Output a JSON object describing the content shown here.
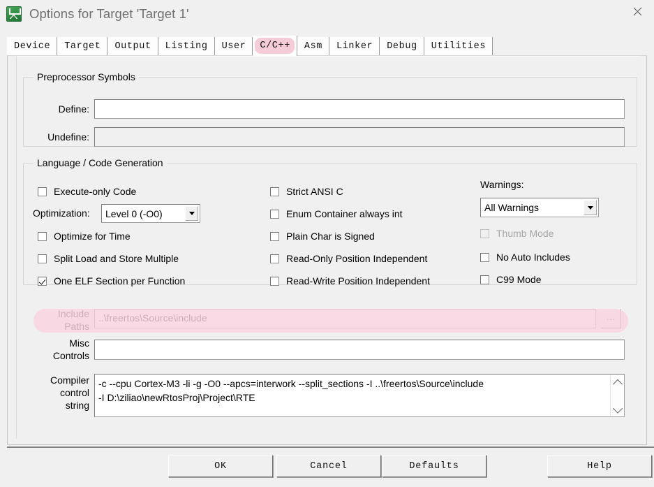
{
  "window": {
    "title": "Options for Target 'Target 1'",
    "icon": "uvision-logo-icon",
    "close_label": "✕"
  },
  "tabs": [
    {
      "label": "Device",
      "selected": false
    },
    {
      "label": "Target",
      "selected": false
    },
    {
      "label": "Output",
      "selected": false
    },
    {
      "label": "Listing",
      "selected": false
    },
    {
      "label": "User",
      "selected": false
    },
    {
      "label": "C/C++",
      "selected": true
    },
    {
      "label": "Asm",
      "selected": false
    },
    {
      "label": "Linker",
      "selected": false
    },
    {
      "label": "Debug",
      "selected": false
    },
    {
      "label": "Utilities",
      "selected": false
    }
  ],
  "preprocessor": {
    "legend": "Preprocessor Symbols",
    "define_label": "Define:",
    "define_value": "",
    "undefine_label": "Undefine:",
    "undefine_value": ""
  },
  "language": {
    "legend": "Language / Code Generation",
    "optimization_label": "Optimization:",
    "optimization_value": "Level 0 (-O0)",
    "warnings_label": "Warnings:",
    "warnings_value": "All Warnings",
    "col1": [
      {
        "label": "Execute-only Code",
        "checked": false,
        "disabled": false
      },
      {
        "label": "Optimize for Time",
        "checked": false,
        "disabled": false
      },
      {
        "label": "Split Load and Store Multiple",
        "checked": false,
        "disabled": false
      },
      {
        "label": "One ELF Section per Function",
        "checked": true,
        "disabled": false
      }
    ],
    "col2": [
      {
        "label": "Strict ANSI C",
        "checked": false,
        "disabled": false
      },
      {
        "label": "Enum Container always int",
        "checked": false,
        "disabled": false
      },
      {
        "label": "Plain Char is Signed",
        "checked": false,
        "disabled": false
      },
      {
        "label": "Read-Only Position Independent",
        "checked": false,
        "disabled": false
      },
      {
        "label": "Read-Write Position Independent",
        "checked": false,
        "disabled": false
      }
    ],
    "col3": [
      {
        "label": "Thumb Mode",
        "checked": false,
        "disabled": true
      },
      {
        "label": "No Auto Includes",
        "checked": false,
        "disabled": false
      },
      {
        "label": "C99 Mode",
        "checked": false,
        "disabled": false
      }
    ]
  },
  "paths": {
    "include_label_line1": "Include",
    "include_label_line2": "Paths",
    "include_value": "..\\freertos\\Source\\include",
    "browse_label": "...",
    "misc_label_line1": "Misc",
    "misc_label_line2": "Controls",
    "misc_value": "",
    "compiler_label_line1": "Compiler",
    "compiler_label_line2": "control",
    "compiler_label_line3": "string",
    "compiler_value": "-c --cpu Cortex-M3 -li -g -O0 --apcs=interwork --split_sections -I ..\\freertos\\Source\\include\n-I D:\\ziliao\\newRtosProj\\Project\\RTE"
  },
  "buttons": {
    "ok": "OK",
    "cancel": "Cancel",
    "defaults": "Defaults",
    "help": "Help"
  },
  "colors": {
    "highlight": "#f9d2de",
    "tab_highlight": "#f6ccd8",
    "dialog_bg": "#f0f0f0",
    "title_text": "#6f6f6f"
  }
}
